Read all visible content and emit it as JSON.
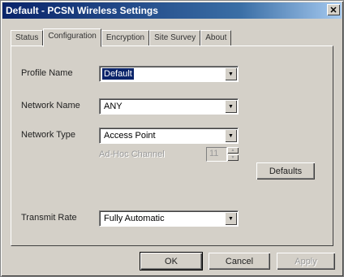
{
  "window": {
    "title": "Default - PCSN Wireless Settings",
    "close_glyph": "✕"
  },
  "tabs": [
    {
      "label": "Status",
      "active": false
    },
    {
      "label": "Configuration",
      "active": true
    },
    {
      "label": "Encryption",
      "active": false
    },
    {
      "label": "Site Survey",
      "active": false
    },
    {
      "label": "About",
      "active": false
    }
  ],
  "config": {
    "profile_name": {
      "label": "Profile Name",
      "value": "Default"
    },
    "network_name": {
      "label": "Network Name",
      "value": "ANY"
    },
    "network_type": {
      "label": "Network Type",
      "value": "Access Point"
    },
    "ad_hoc_channel": {
      "label": "Ad-Hoc Channel",
      "value": "11"
    },
    "transmit_rate": {
      "label": "Transmit Rate",
      "value": "Fully Automatic"
    },
    "defaults_button": "Defaults"
  },
  "footer": {
    "ok_label": "OK",
    "cancel_label": "Cancel",
    "apply_label": "Apply"
  },
  "icons": {
    "dropdown_arrow": "▼",
    "spin_up": "▲",
    "spin_down": "▼"
  }
}
